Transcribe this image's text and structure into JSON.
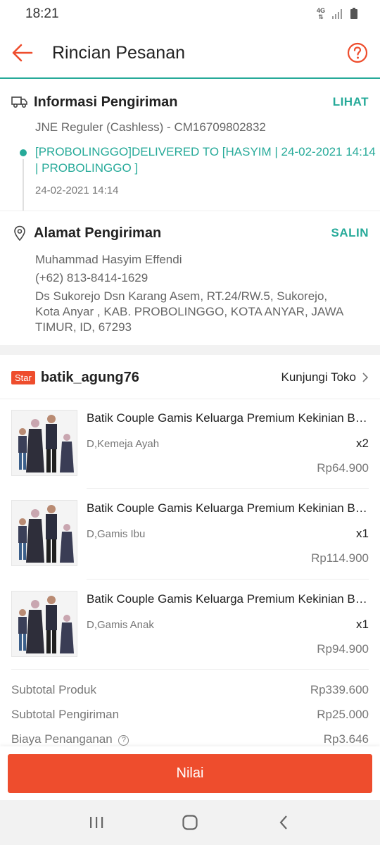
{
  "status_bar": {
    "time": "18:21",
    "network": "4G"
  },
  "header": {
    "title": "Rincian Pesanan",
    "back_icon": "arrow-left-icon",
    "help_icon": "help-circle-icon"
  },
  "shipping_info": {
    "title": "Informasi Pengiriman",
    "action": "LIHAT",
    "courier": "JNE Reguler (Cashless) - CM16709802832",
    "tracking_line1": "[PROBOLINGGO]DELIVERED TO [HASYIM | 24-02-2021 14:14",
    "tracking_line2": "| PROBOLINGGO ]",
    "tracking_time": "24-02-2021 14:14"
  },
  "address": {
    "title": "Alamat Pengiriman",
    "action": "SALIN",
    "name": "Muhammad Hasyim Effendi",
    "phone": "(+62) 813-8414-1629",
    "line1": "Ds Sukorejo Dsn Karang Asem, RT.24/RW.5, Sukorejo,",
    "line2": "Kota Anyar , KAB. PROBOLINGGO, KOTA ANYAR, JAWA",
    "line3": "TIMUR, ID, 67293"
  },
  "shop": {
    "badge": "Star",
    "name": "batik_agung76",
    "visit_label": "Kunjungi Toko"
  },
  "products": [
    {
      "name": "Batik Couple Gamis Keluarga Premium Kekinian Batik",
      "variant": "D,Kemeja Ayah",
      "qty": "x2",
      "price": "Rp64.900"
    },
    {
      "name": "Batik Couple Gamis Keluarga Premium Kekinian Batik",
      "variant": "D,Gamis Ibu",
      "qty": "x1",
      "price": "Rp114.900"
    },
    {
      "name": "Batik Couple Gamis Keluarga Premium Kekinian Batik",
      "variant": "D,Gamis Anak",
      "qty": "x1",
      "price": "Rp94.900"
    }
  ],
  "summary": {
    "subtotal_label": "Subtotal Produk",
    "subtotal_value": "Rp339.600",
    "shipping_label": "Subtotal Pengiriman",
    "shipping_value": "Rp25.000",
    "handling_label": "Biaya Penanganan",
    "handling_value": "Rp3.646"
  },
  "action": {
    "button_label": "Nilai"
  },
  "colors": {
    "accent": "#ee4d2d",
    "teal": "#26aa99"
  }
}
